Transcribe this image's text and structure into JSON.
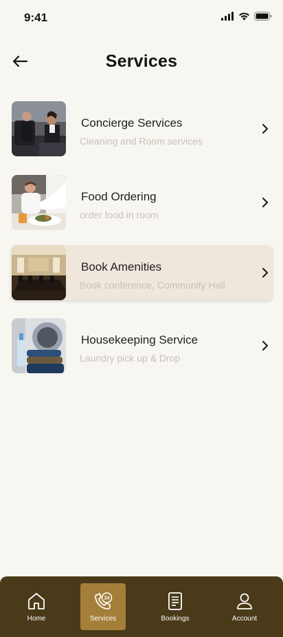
{
  "status_bar": {
    "time": "9:41"
  },
  "header": {
    "title": "Services"
  },
  "services": [
    {
      "title": "Concierge Services",
      "subtitle": "Cleaning and Room services",
      "image": "concierge-photo"
    },
    {
      "title": "Food Ordering",
      "subtitle": "order food in room",
      "image": "food-photo"
    },
    {
      "title": "Book Amenities",
      "subtitle": "Book conference, Community Hall",
      "image": "conference-room-photo",
      "active": true
    },
    {
      "title": "Housekeeping Service",
      "subtitle": "Laundry pick up & Drop",
      "image": "laundry-photo"
    }
  ],
  "bottom_nav": {
    "items": [
      {
        "label": "Home",
        "icon": "home-icon"
      },
      {
        "label": "Services",
        "icon": "phone-24-icon",
        "active": true
      },
      {
        "label": "Bookings",
        "icon": "document-icon"
      },
      {
        "label": "Account",
        "icon": "user-icon"
      }
    ]
  },
  "colors": {
    "background": "#f8f6f1",
    "nav_background": "#4a3a19",
    "nav_active": "#a47f3a",
    "active_row": "#efe6dc"
  }
}
